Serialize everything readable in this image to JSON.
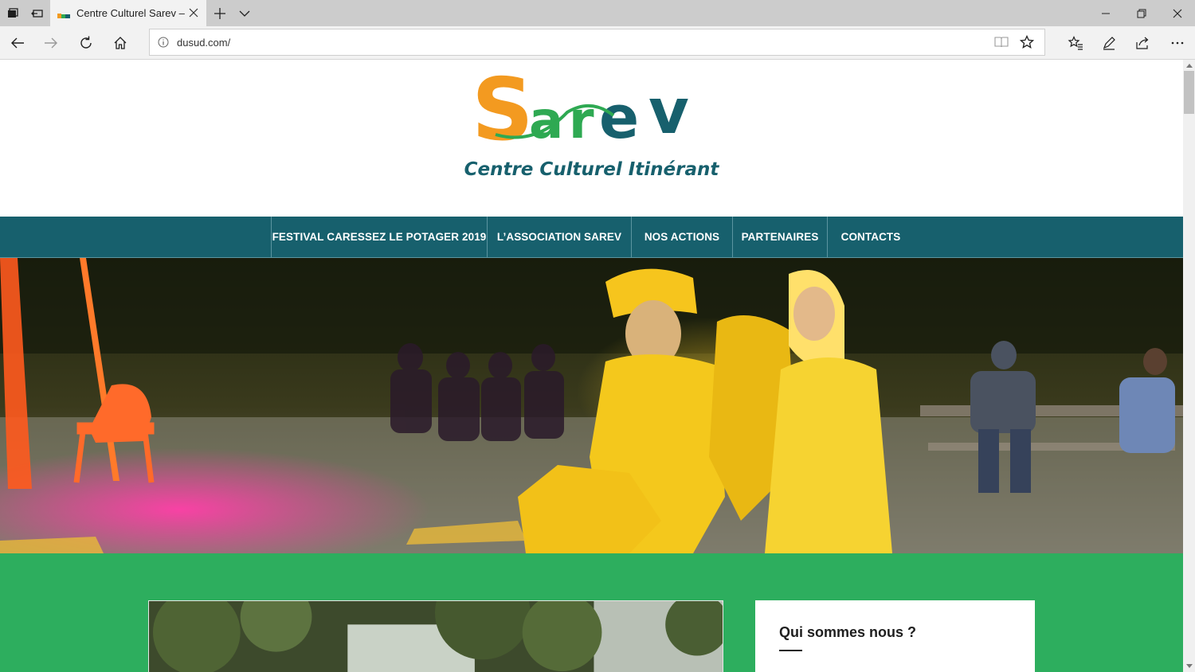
{
  "browser": {
    "tab_title": "Centre Culturel Sarev –",
    "url": "dusud.com/"
  },
  "site": {
    "logo_text": "Sarev",
    "tagline": "Centre Culturel Itinérant",
    "colors": {
      "menu_bg": "#17606d",
      "section_bg": "#2dae5e",
      "logo_orange": "#f39a20",
      "logo_green": "#2ea952",
      "logo_teal": "#17606d"
    }
  },
  "menu": {
    "items": [
      {
        "label": "FESTIVAL CARESSEZ LE POTAGER 2019"
      },
      {
        "label": "L’ASSOCIATION SAREV"
      },
      {
        "label": "NOS ACTIONS"
      },
      {
        "label": "PARTENAIRES"
      },
      {
        "label": "CONTACTS"
      }
    ]
  },
  "about": {
    "title": "Qui sommes nous ?"
  },
  "icons": [
    "tab-actions-icon",
    "tabs-aside-icon",
    "close-icon",
    "new-tab-icon",
    "chevron-down-icon",
    "minimize-icon",
    "restore-icon",
    "back-icon",
    "forward-icon",
    "refresh-icon",
    "home-icon",
    "info-icon",
    "reading-view-icon",
    "favorite-star-icon",
    "favorites-hub-icon",
    "pen-icon",
    "share-icon",
    "more-icon"
  ]
}
